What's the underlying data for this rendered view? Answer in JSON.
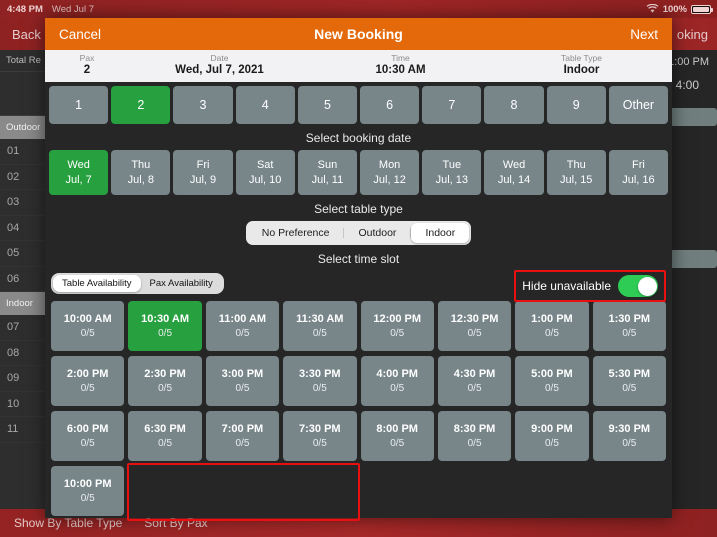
{
  "status_bar": {
    "time": "4:48 PM",
    "date": "Wed Jul 7",
    "battery_pct": "100%",
    "wifi_icon": "wifi-icon",
    "battery_icon": "battery-full-icon"
  },
  "background_app": {
    "back_label": "Back",
    "new_booking_label": "oking",
    "total_label": "Total Re",
    "time_header_1": "1:00 PM",
    "time_header_2": "4:00",
    "sections": [
      {
        "name": "Outdoor",
        "tables": [
          "01",
          "02",
          "03",
          "04",
          "05",
          "06"
        ]
      },
      {
        "name": "Indoor",
        "tables": [
          "07",
          "08",
          "09",
          "10",
          "11"
        ]
      }
    ],
    "bottom_bar": {
      "show_by": "Show By Table Type",
      "sort_by": "Sort By Pax"
    }
  },
  "modal": {
    "cancel_label": "Cancel",
    "title": "New Booking",
    "next_label": "Next",
    "summary": [
      {
        "label": "Pax",
        "value": "2"
      },
      {
        "label": "Date",
        "value": "Wed, Jul 7, 2021"
      },
      {
        "label": "Time",
        "value": "10:30 AM"
      },
      {
        "label": "Table Type",
        "value": "Indoor"
      }
    ],
    "pax_options": [
      {
        "label": "1",
        "selected": false
      },
      {
        "label": "2",
        "selected": true
      },
      {
        "label": "3",
        "selected": false
      },
      {
        "label": "4",
        "selected": false
      },
      {
        "label": "5",
        "selected": false
      },
      {
        "label": "6",
        "selected": false
      },
      {
        "label": "7",
        "selected": false
      },
      {
        "label": "8",
        "selected": false
      },
      {
        "label": "9",
        "selected": false
      },
      {
        "label": "Other",
        "selected": false
      }
    ],
    "date_section_title": "Select booking date",
    "dates": [
      {
        "day": "Wed",
        "date": "Jul, 7",
        "selected": true
      },
      {
        "day": "Thu",
        "date": "Jul, 8",
        "selected": false
      },
      {
        "day": "Fri",
        "date": "Jul, 9",
        "selected": false
      },
      {
        "day": "Sat",
        "date": "Jul, 10",
        "selected": false
      },
      {
        "day": "Sun",
        "date": "Jul, 11",
        "selected": false
      },
      {
        "day": "Mon",
        "date": "Jul, 12",
        "selected": false
      },
      {
        "day": "Tue",
        "date": "Jul, 13",
        "selected": false
      },
      {
        "day": "Wed",
        "date": "Jul, 14",
        "selected": false
      },
      {
        "day": "Thu",
        "date": "Jul, 15",
        "selected": false
      },
      {
        "day": "Fri",
        "date": "Jul, 16",
        "selected": false
      }
    ],
    "table_type_section_title": "Select table type",
    "table_types": [
      {
        "label": "No Preference",
        "selected": false
      },
      {
        "label": "Outdoor",
        "selected": false
      },
      {
        "label": "Indoor",
        "selected": true
      }
    ],
    "time_slot_section_title": "Select time slot",
    "availability_modes": [
      {
        "label": "Table Availability",
        "selected": true
      },
      {
        "label": "Pax Availability",
        "selected": false
      }
    ],
    "hide_unavailable": {
      "label": "Hide unavailable",
      "on": true
    },
    "time_slots": [
      {
        "time": "10:00 AM",
        "capacity": "0/5",
        "selected": false
      },
      {
        "time": "10:30 AM",
        "capacity": "0/5",
        "selected": true
      },
      {
        "time": "11:00 AM",
        "capacity": "0/5",
        "selected": false
      },
      {
        "time": "11:30 AM",
        "capacity": "0/5",
        "selected": false
      },
      {
        "time": "12:00 PM",
        "capacity": "0/5",
        "selected": false
      },
      {
        "time": "12:30 PM",
        "capacity": "0/5",
        "selected": false
      },
      {
        "time": "1:00 PM",
        "capacity": "0/5",
        "selected": false
      },
      {
        "time": "1:30 PM",
        "capacity": "0/5",
        "selected": false
      },
      {
        "time": "2:00 PM",
        "capacity": "0/5",
        "selected": false
      },
      {
        "time": "2:30 PM",
        "capacity": "0/5",
        "selected": false
      },
      {
        "time": "3:00 PM",
        "capacity": "0/5",
        "selected": false
      },
      {
        "time": "3:30 PM",
        "capacity": "0/5",
        "selected": false
      },
      {
        "time": "4:00 PM",
        "capacity": "0/5",
        "selected": false
      },
      {
        "time": "4:30 PM",
        "capacity": "0/5",
        "selected": false
      },
      {
        "time": "5:00 PM",
        "capacity": "0/5",
        "selected": false
      },
      {
        "time": "5:30 PM",
        "capacity": "0/5",
        "selected": false
      },
      {
        "time": "6:00 PM",
        "capacity": "0/5",
        "selected": false
      },
      {
        "time": "6:30 PM",
        "capacity": "0/5",
        "selected": false
      },
      {
        "time": "7:00 PM",
        "capacity": "0/5",
        "selected": false
      },
      {
        "time": "7:30 PM",
        "capacity": "0/5",
        "selected": false
      },
      {
        "time": "8:00 PM",
        "capacity": "0/5",
        "selected": false
      },
      {
        "time": "8:30 PM",
        "capacity": "0/5",
        "selected": false
      },
      {
        "time": "9:00 PM",
        "capacity": "0/5",
        "selected": false
      },
      {
        "time": "9:30 PM",
        "capacity": "0/5",
        "selected": false
      },
      {
        "time": "10:00 PM",
        "capacity": "0/5",
        "selected": false
      }
    ]
  },
  "colors": {
    "accent_orange": "#e4690b",
    "selected_green": "#27a03f",
    "slot_gray": "#78868a",
    "annotation_red": "#e81010"
  },
  "annotations": [
    {
      "name": "hide-unavailable-highlight"
    },
    {
      "name": "empty-slot-area-highlight"
    }
  ]
}
